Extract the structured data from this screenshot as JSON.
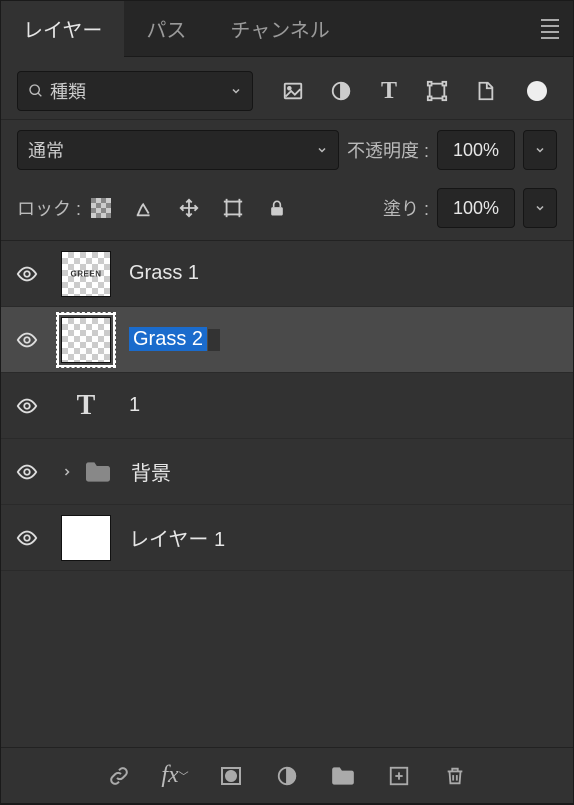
{
  "tabs": {
    "layers": "レイヤー",
    "paths": "パス",
    "channels": "チャンネル"
  },
  "filter": {
    "placeholder": "種類"
  },
  "blend": {
    "mode": "通常",
    "opacity_label": "不透明度 :",
    "opacity_value": "100%"
  },
  "lock": {
    "label": "ロック :",
    "fill_label": "塗り :",
    "fill_value": "100%"
  },
  "layers": [
    {
      "name": "Grass 1"
    },
    {
      "name": "Grass 2"
    },
    {
      "name": "1"
    },
    {
      "name": "背景"
    },
    {
      "name": "レイヤー 1"
    }
  ]
}
